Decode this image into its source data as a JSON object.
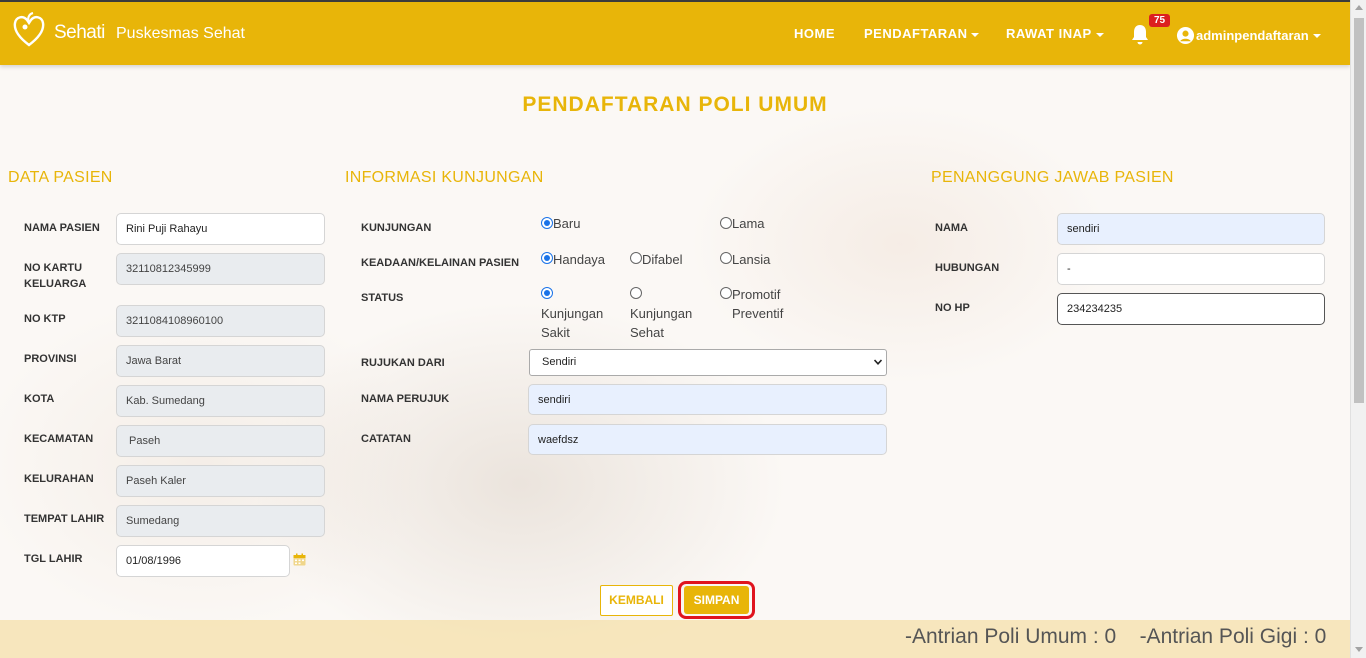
{
  "navbar": {
    "logo_text": "Sehati",
    "brand": "Puskesmas Sehat",
    "items": [
      {
        "label": "HOME",
        "dropdown": false
      },
      {
        "label": "PENDAFTARAN",
        "dropdown": true
      },
      {
        "label": "RAWAT INAP",
        "dropdown": true
      }
    ],
    "notification_count": "75",
    "user": "adminpendaftaran",
    "bg_color": "#e8b509"
  },
  "page_title": "PENDAFTARAN POLI UMUM",
  "data_pasien": {
    "title": "DATA PASIEN",
    "fields": [
      {
        "label": "NAMA PASIEN",
        "value": "Rini Puji Rahayu",
        "readonly": false
      },
      {
        "label": "NO KARTU KELUARGA",
        "value": "32110812345999",
        "readonly": true
      },
      {
        "label": "NO KTP",
        "value": "3211084108960100",
        "readonly": true
      },
      {
        "label": "PROVINSI",
        "value": "Jawa Barat",
        "readonly": true
      },
      {
        "label": "KOTA",
        "value": "Kab. Sumedang",
        "readonly": true
      },
      {
        "label": "KECAMATAN",
        "value": " Paseh",
        "readonly": true
      },
      {
        "label": "KELURAHAN",
        "value": "Paseh Kaler",
        "readonly": true
      },
      {
        "label": "TEMPAT LAHIR",
        "value": "Sumedang",
        "readonly": true
      },
      {
        "label": "TGL LAHIR",
        "value": "01/08/1996",
        "readonly": false
      }
    ]
  },
  "informasi_kunjungan": {
    "title": "INFORMASI KUNJUNGAN",
    "kunjungan": {
      "label": "KUNJUNGAN",
      "options": [
        "Baru",
        "Lama"
      ],
      "selected": "Baru"
    },
    "keadaan": {
      "label": "KEADAAN/KELAINAN PASIEN",
      "options": [
        "Handaya",
        "Difabel",
        "Lansia"
      ],
      "selected": "Handaya"
    },
    "status": {
      "label": "STATUS",
      "options": [
        "Kunjungan Sakit",
        "Kunjungan Sehat",
        "Promotif Preventif"
      ],
      "selected": "Kunjungan Sakit"
    },
    "rujukan": {
      "label": "RUJUKAN DARI",
      "value": "Sendiri"
    },
    "nama_perujuk": {
      "label": "NAMA PERUJUK",
      "value": "sendiri"
    },
    "catatan": {
      "label": "CATATAN",
      "value": "waefdsz"
    }
  },
  "penanggung_jawab": {
    "title": "PENANGGUNG JAWAB PASIEN",
    "nama": {
      "label": "NAMA",
      "value": "sendiri"
    },
    "hubungan": {
      "label": "HUBUNGAN",
      "value": "-"
    },
    "no_hp": {
      "label": "NO HP",
      "value": "234234235"
    }
  },
  "buttons": {
    "back": "KEMBALI",
    "save": "SIMPAN"
  },
  "ticker": "-Antrian Poli Umum : 0    -Antrian Poli Gigi : 0",
  "icons": [
    "heart-logo-icon",
    "bell-icon",
    "user-circle-icon",
    "calendar-icon",
    "chevron-down-icon"
  ]
}
